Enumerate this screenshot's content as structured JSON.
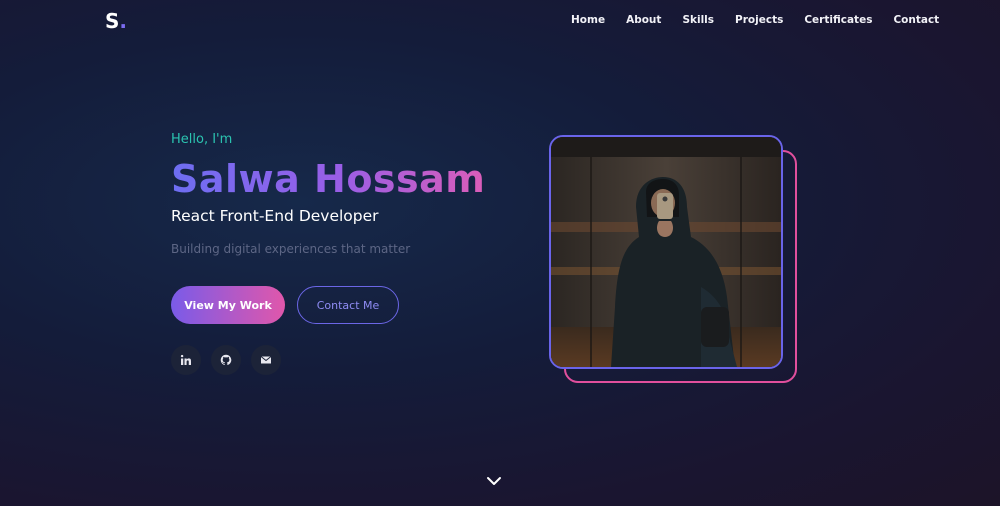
{
  "brand": {
    "logo_letter": "S",
    "logo_dot": "."
  },
  "nav": {
    "items": [
      {
        "label": "Home"
      },
      {
        "label": "About"
      },
      {
        "label": "Skills"
      },
      {
        "label": "Projects"
      },
      {
        "label": "Certificates"
      },
      {
        "label": "Contact"
      }
    ]
  },
  "hero": {
    "greeting": "Hello, I'm",
    "name": "Salwa Hossam",
    "role": "React Front-End Developer",
    "tagline": "Building digital experiences that matter",
    "primary_button": "View My Work",
    "secondary_button": "Contact Me"
  },
  "socials": [
    {
      "icon": "linkedin-icon"
    },
    {
      "icon": "github-icon"
    },
    {
      "icon": "envelope-icon"
    }
  ],
  "photo": {
    "subject": "profile-photo"
  },
  "colors": {
    "accent_teal": "#2bc3b0",
    "accent_purple": "#6d6ef2",
    "accent_pink": "#e65db0",
    "background": "#141c3a"
  },
  "scroll_icon": "chevron-down-icon"
}
